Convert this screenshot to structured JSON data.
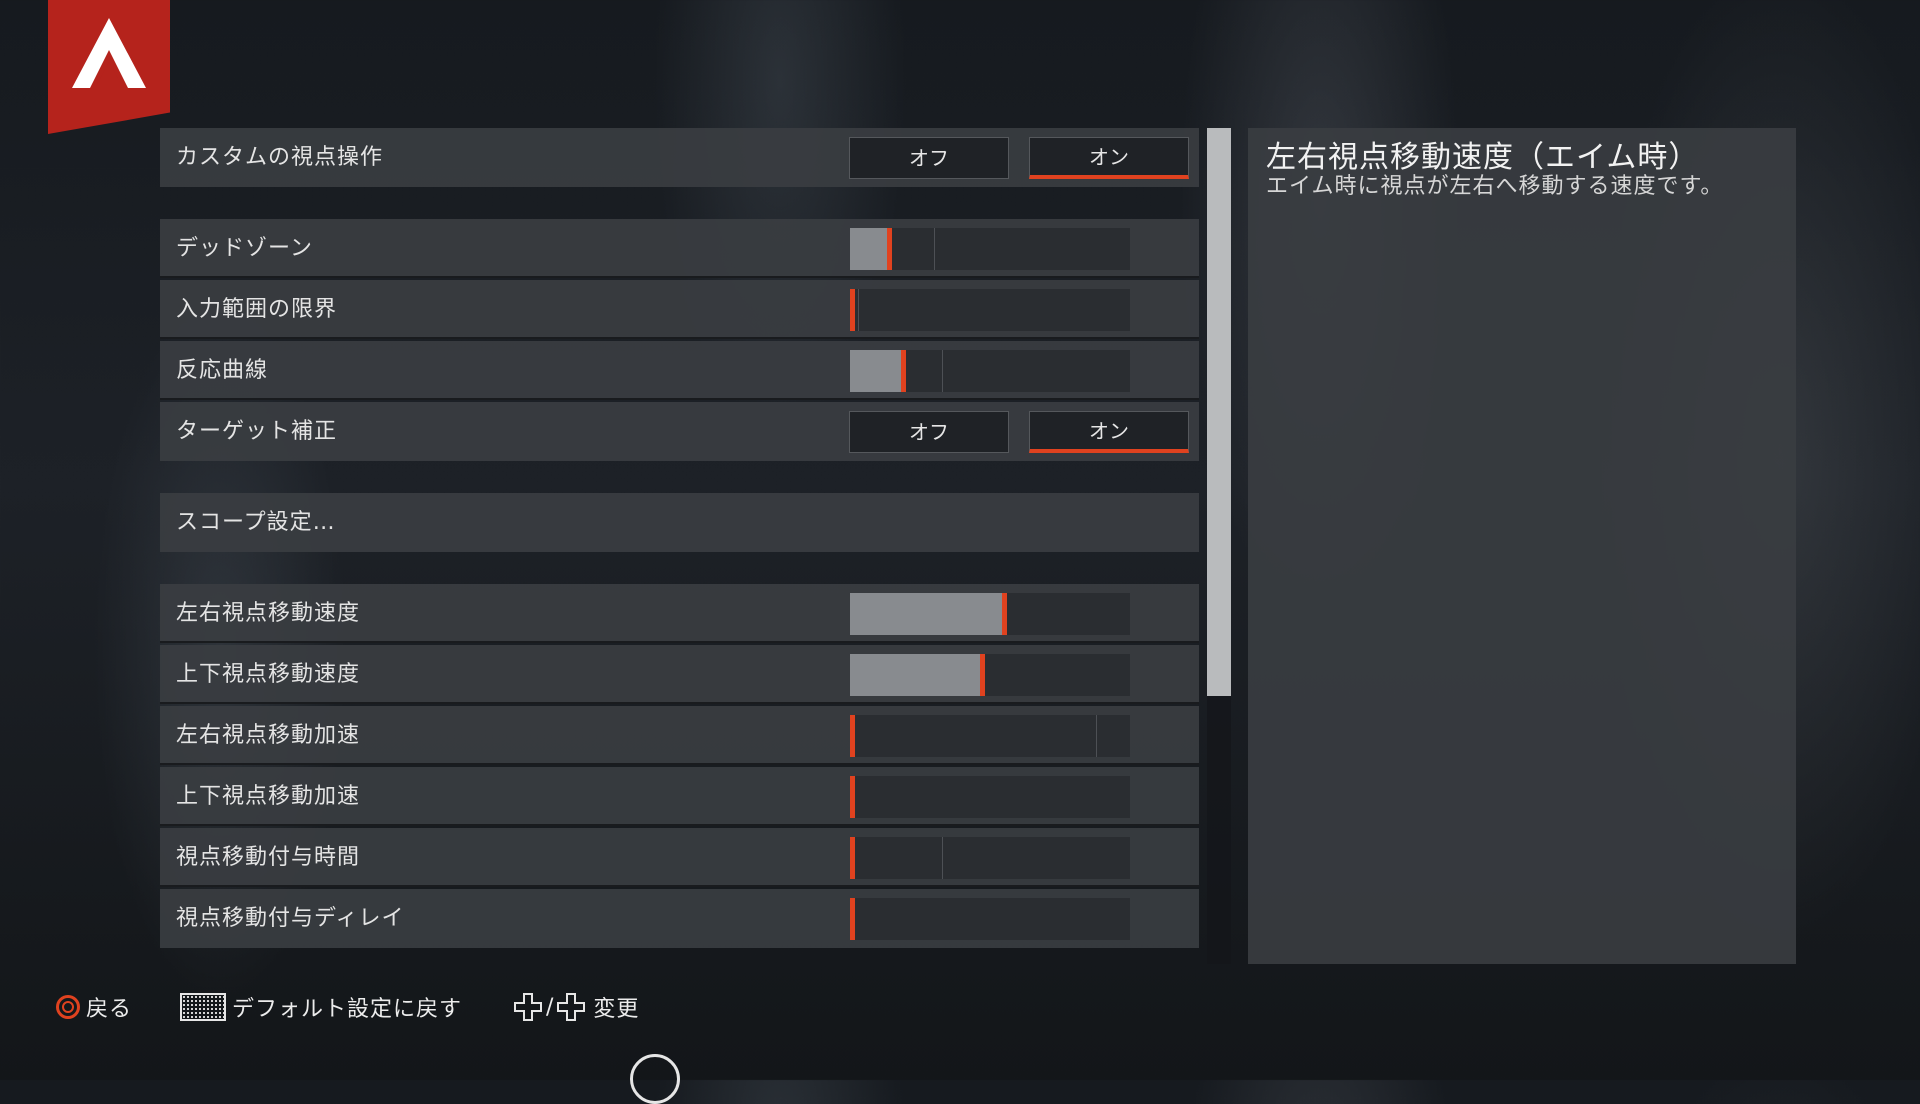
{
  "brand": {
    "accent_color": "#e0421f",
    "logo_color": "#b5231c",
    "logo_icon": "apex-logo-icon"
  },
  "settings": {
    "custom_look": {
      "label": "カスタムの視点操作",
      "off_label": "オフ",
      "on_label": "オン",
      "selected": "オン"
    },
    "deadzone": {
      "label": "デッドゾーン",
      "value": 0.14,
      "default_mark": 0.3
    },
    "outer_threshold": {
      "label": "入力範囲の限界",
      "value": 0.0,
      "default_mark": 0.03
    },
    "response_curve": {
      "label": "反応曲線",
      "value": 0.19,
      "default_mark": 0.33
    },
    "target_compensation": {
      "label": "ターゲット補正",
      "off_label": "オフ",
      "on_label": "オン",
      "selected": "オン"
    },
    "scope_settings": {
      "label": "スコープ設定…"
    },
    "yaw_speed": {
      "label": "左右視点移動速度",
      "value": 0.55,
      "default_mark": 0.32
    },
    "pitch_speed": {
      "label": "上下視点移動速度",
      "value": 0.47,
      "default_mark": 0.24
    },
    "yaw_ramp": {
      "label": "左右視点移動加速",
      "value": 0.0,
      "default_mark": 0.88
    },
    "pitch_ramp": {
      "label": "上下視点移動加速",
      "value": 0.0,
      "default_mark": null
    },
    "ramp_time": {
      "label": "視点移動付与時間",
      "value": 0.0,
      "default_mark": 0.33
    },
    "ramp_delay": {
      "label": "視点移動付与ディレイ",
      "value": 0.0,
      "default_mark": null
    }
  },
  "description": {
    "title": "左右視点移動速度（エイム時）",
    "text": "エイム時に視点が左右へ移動する速度です。"
  },
  "scroll": {
    "position": 0,
    "thumb_fraction": 0.68
  },
  "footer": {
    "back": {
      "label": "戻る",
      "icon": "circle-button-icon"
    },
    "reset": {
      "label": "デフォルト設定に戻す",
      "icon": "touchpad-icon"
    },
    "change": {
      "label": "変更",
      "icon": "dpad-icon",
      "separator": "/"
    }
  }
}
